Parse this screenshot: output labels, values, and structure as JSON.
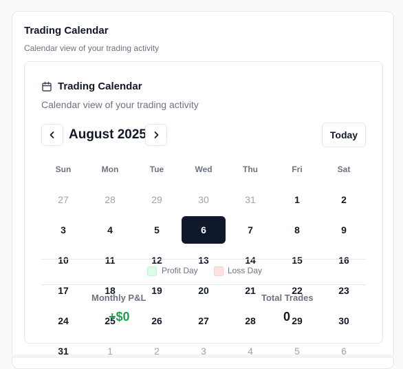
{
  "outer": {
    "title": "Trading Calendar",
    "subtitle": "Calendar view of your trading activity"
  },
  "inner": {
    "title": "Trading Calendar",
    "subtitle": "Calendar view of your trading activity"
  },
  "nav": {
    "month": "August 2025",
    "today_label": "Today",
    "prev_icon": "chevron-left-icon",
    "next_icon": "chevron-right-icon"
  },
  "weekdays": [
    "Sun",
    "Mon",
    "Tue",
    "Wed",
    "Thu",
    "Fri",
    "Sat"
  ],
  "weeks": [
    [
      {
        "d": "27",
        "m": true
      },
      {
        "d": "28",
        "m": true
      },
      {
        "d": "29",
        "m": true
      },
      {
        "d": "30",
        "m": true
      },
      {
        "d": "31",
        "m": true
      },
      {
        "d": "1",
        "m": false
      },
      {
        "d": "2",
        "m": false
      }
    ],
    [
      {
        "d": "3",
        "m": false
      },
      {
        "d": "4",
        "m": false
      },
      {
        "d": "5",
        "m": false
      },
      {
        "d": "6",
        "m": false,
        "selected": true
      },
      {
        "d": "7",
        "m": false
      },
      {
        "d": "8",
        "m": false
      },
      {
        "d": "9",
        "m": false
      }
    ],
    [
      {
        "d": "10",
        "m": false
      },
      {
        "d": "11",
        "m": false
      },
      {
        "d": "12",
        "m": false
      },
      {
        "d": "13",
        "m": false
      },
      {
        "d": "14",
        "m": false
      },
      {
        "d": "15",
        "m": false
      },
      {
        "d": "16",
        "m": false
      }
    ],
    [
      {
        "d": "17",
        "m": false
      },
      {
        "d": "18",
        "m": false
      },
      {
        "d": "19",
        "m": false
      },
      {
        "d": "20",
        "m": false
      },
      {
        "d": "21",
        "m": false
      },
      {
        "d": "22",
        "m": false
      },
      {
        "d": "23",
        "m": false
      }
    ],
    [
      {
        "d": "24",
        "m": false
      },
      {
        "d": "25",
        "m": false
      },
      {
        "d": "26",
        "m": false
      },
      {
        "d": "27",
        "m": false
      },
      {
        "d": "28",
        "m": false
      },
      {
        "d": "29",
        "m": false
      },
      {
        "d": "30",
        "m": false
      }
    ],
    [
      {
        "d": "31",
        "m": false
      },
      {
        "d": "1",
        "m": true
      },
      {
        "d": "2",
        "m": true
      },
      {
        "d": "3",
        "m": true
      },
      {
        "d": "4",
        "m": true
      },
      {
        "d": "5",
        "m": true
      },
      {
        "d": "6",
        "m": true
      }
    ]
  ],
  "legend": {
    "profit_label": "Profit Day",
    "loss_label": "Loss Day",
    "profit_color": "#dcfce7",
    "profit_border": "#bbf7d0",
    "loss_color": "#fee2e2",
    "loss_border": "#fecaca"
  },
  "stats": {
    "pnl_label": "Monthly P&L",
    "pnl_value": "+$0",
    "pnl_color": "#16a34a",
    "trades_label": "Total Trades",
    "trades_value": "0"
  },
  "colors": {
    "selected_bg": "#0f172a",
    "muted_text": "#9ca3af"
  }
}
